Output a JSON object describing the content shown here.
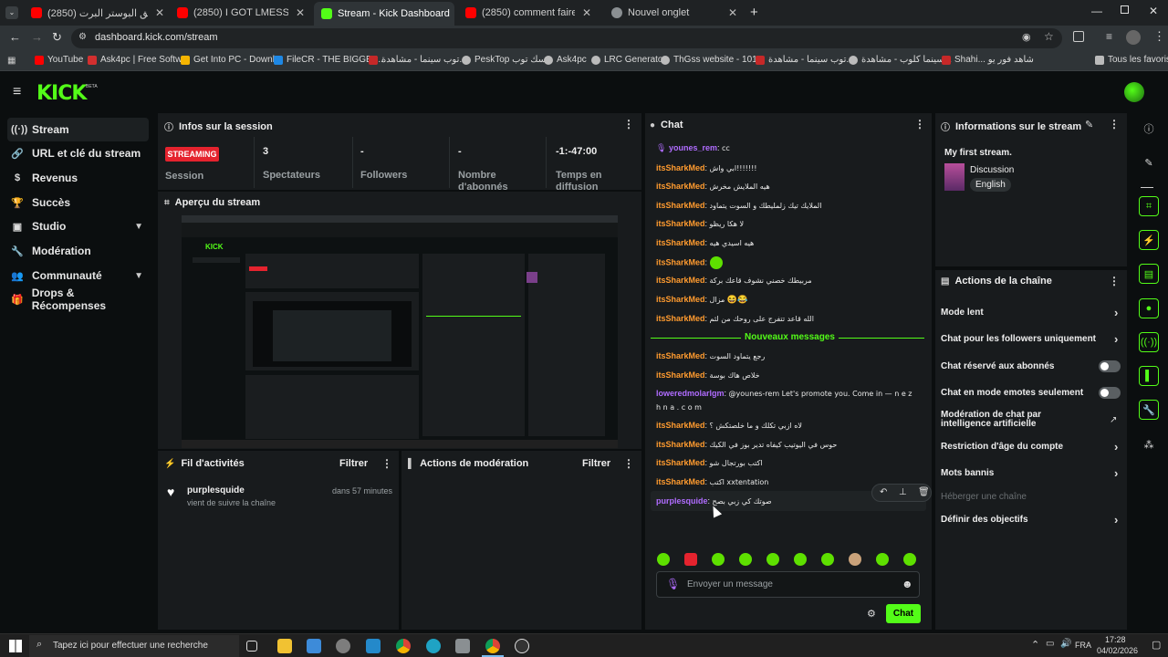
{
  "browser": {
    "tabs": [
      {
        "label": "(2850) طورت فريق البوستر البرت"
      },
      {
        "label": "(2850) I GOT LMESSI 103 RATED"
      },
      {
        "label": "Stream - Kick Dashboard"
      },
      {
        "label": "(2850) comment faire pause live"
      },
      {
        "label": "Nouvel onglet"
      }
    ],
    "url": "dashboard.kick.com/stream",
    "bookmarks": [
      "YouTube",
      "Ask4pc | Free Softw...",
      "Get Into PC - Downl...",
      "FileCR - THE BIGGES...",
      "توب سينما - مشاهدة...",
      "PeskTop بيسك توب",
      "Ask4pc",
      "LRC Generator",
      "ThGss website - 101...",
      "توب سينما - مشاهدة...",
      "سينما كلوب - مشاهدة...",
      "Shahi... شاهد فور يو"
    ],
    "all_favorites": "Tous les favoris"
  },
  "app": {
    "logo": "KICK",
    "beta": "BETA"
  },
  "sidebar": {
    "items": [
      {
        "label": "Stream",
        "icon": "signal-icon"
      },
      {
        "label": "URL et clé du stream",
        "icon": "link-icon"
      },
      {
        "label": "Revenus",
        "icon": "money-icon"
      },
      {
        "label": "Succès",
        "icon": "trophy-icon"
      },
      {
        "label": "Studio",
        "icon": "studio-icon"
      },
      {
        "label": "Modération",
        "icon": "wrench-icon"
      },
      {
        "label": "Communauté",
        "icon": "people-icon"
      },
      {
        "label": "Drops & Récompenses",
        "icon": "gift-icon"
      }
    ]
  },
  "session": {
    "title": "Infos sur la session",
    "badge": "STREAMING",
    "badge_label": "Session",
    "stats": [
      {
        "value": "3",
        "label": "Spectateurs"
      },
      {
        "value": "-",
        "label": "Followers"
      },
      {
        "value": "-",
        "label": "Nombre d'abonnés"
      },
      {
        "value": "-1:-47:00",
        "label": "Temps en diffusion"
      }
    ]
  },
  "preview": {
    "title": "Aperçu du stream"
  },
  "activity": {
    "title": "Fil d'activités",
    "filter": "Filtrer",
    "items": [
      {
        "user": "purplesquide",
        "text": "vient de suivre la chaîne",
        "time": "dans 57 minutes"
      }
    ]
  },
  "moderation": {
    "title": "Actions de modération",
    "filter": "Filtrer"
  },
  "chat": {
    "title": "Chat",
    "messages": [
      {
        "user": "younes_rem",
        "text": "cc",
        "color": "#b06cff"
      },
      {
        "user": "itsSharkMed",
        "text": "ابي واش!!!!!!!",
        "color": "#ff9b2f"
      },
      {
        "user": "itsSharkMed",
        "text": "هيه الملايش مخرش",
        "color": "#ff9b2f"
      },
      {
        "user": "itsSharkMed",
        "text": "الملايك تيك زلمليطك و السوت يتماود",
        "color": "#ff9b2f"
      },
      {
        "user": "itsSharkMed",
        "text": "لا هكا ريظو",
        "color": "#ff9b2f"
      },
      {
        "user": "itsSharkMed",
        "text": "هيه اسيدي هيه",
        "color": "#ff9b2f"
      },
      {
        "user": "itsSharkMed",
        "text": "",
        "color": "#ff9b2f"
      },
      {
        "user": "itsSharkMed",
        "text": "مربيطك خصني نشوف قاعك بركة",
        "color": "#ff9b2f"
      },
      {
        "user": "itsSharkMed",
        "text": "مزال",
        "color": "#ff9b2f"
      },
      {
        "user": "itsSharkMed",
        "text": "الله قاعد تتفرج على روحك من لثم",
        "color": "#ff9b2f"
      }
    ],
    "new_messages": "Nouveaux messages",
    "messages2": [
      {
        "user": "itsSharkMed",
        "text": "رجع يتماود السوت",
        "color": "#ff9b2f"
      },
      {
        "user": "itsSharkMed",
        "text": "خلاص هاك بوسة",
        "color": "#ff9b2f"
      },
      {
        "user": "loweredmolarlgm",
        "text": "@younes-rem Let's promote you. Come in — n e z",
        "text2": "h n a . c o m",
        "color": "#b06cff"
      },
      {
        "user": "itsSharkMed",
        "text": "لاه ازبي تكلك و ما خلصتكش ؟",
        "color": "#ff9b2f"
      },
      {
        "user": "itsSharkMed",
        "text": "حوس في اليوتيب كيفاه تدير بوز في الكيك",
        "color": "#ff9b2f"
      },
      {
        "user": "itsSharkMed",
        "text": "اكتب بورتجال شو",
        "color": "#ff9b2f"
      },
      {
        "user": "itsSharkMed",
        "text": "اكتب xxtentation",
        "color": "#ff9b2f"
      },
      {
        "user": "purplesquide",
        "text": "صوتك كي زبي بصح",
        "color": "#b06cff"
      }
    ],
    "input_placeholder": "Envoyer un message",
    "send_label": "Chat"
  },
  "stream_info": {
    "title": "Informations sur le stream",
    "stream_title": "My first stream.",
    "category": "Discussion",
    "language": "English"
  },
  "channel_actions": {
    "title": "Actions de la chaîne",
    "items": [
      {
        "label": "Mode lent",
        "kind": "arrow"
      },
      {
        "label": "Chat pour les followers uniquement",
        "kind": "arrow"
      },
      {
        "label": "Chat réservé aux abonnés",
        "kind": "toggle"
      },
      {
        "label": "Chat en mode emotes seulement",
        "kind": "toggle"
      },
      {
        "label": "Modération de chat par intelligence artificielle",
        "kind": "external"
      },
      {
        "label": "Restriction d'âge du compte",
        "kind": "arrow"
      },
      {
        "label": "Mots bannis",
        "kind": "arrow"
      },
      {
        "label": "Héberger une chaîne",
        "kind": "disabled"
      },
      {
        "label": "Définir des objectifs",
        "kind": "arrow"
      }
    ]
  },
  "taskbar": {
    "search_placeholder": "Tapez ici pour effectuer une recherche",
    "lang": "FRA",
    "time": "17:28",
    "date": "04/02/2026"
  },
  "colors": {
    "accent": "#53fc18",
    "live": "#e5232e"
  }
}
